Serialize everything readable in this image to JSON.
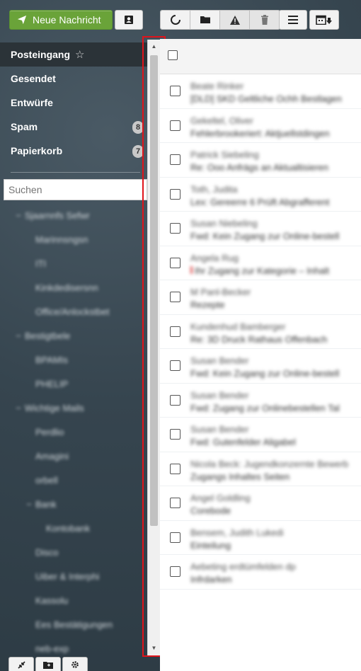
{
  "toolbar": {
    "compose_label": "Neue Nachricht"
  },
  "sidebar": {
    "folders": [
      {
        "label": "Posteingang",
        "badge": ""
      },
      {
        "label": "Gesendet",
        "badge": ""
      },
      {
        "label": "Entwürfe",
        "badge": ""
      },
      {
        "label": "Spam",
        "badge": "8"
      },
      {
        "label": "Papierkorb",
        "badge": "7"
      }
    ],
    "search_placeholder": "Suchen",
    "tree": [
      {
        "label": "Sjaarnnfs Sefwr",
        "depth": 0,
        "toggle": "−"
      },
      {
        "label": "Marinnsngsn",
        "depth": 1,
        "toggle": ""
      },
      {
        "label": "ITI",
        "depth": 1,
        "toggle": ""
      },
      {
        "label": "Kinkdedisersnn",
        "depth": 1,
        "toggle": ""
      },
      {
        "label": "Office/Anlockstbet",
        "depth": 1,
        "toggle": ""
      },
      {
        "label": "Bestigtbele",
        "depth": 0,
        "toggle": "−"
      },
      {
        "label": "BPAMIs",
        "depth": 1,
        "toggle": ""
      },
      {
        "label": "PHELIP",
        "depth": 1,
        "toggle": ""
      },
      {
        "label": "Wichtige Mails",
        "depth": 0,
        "toggle": "−"
      },
      {
        "label": "Perdlio",
        "depth": 1,
        "toggle": ""
      },
      {
        "label": "Amagini",
        "depth": 1,
        "toggle": ""
      },
      {
        "label": "orbell",
        "depth": 1,
        "toggle": ""
      },
      {
        "label": "Bank",
        "depth": 1,
        "toggle": "−"
      },
      {
        "label": "Kontobank",
        "depth": 2,
        "toggle": ""
      },
      {
        "label": "Disco",
        "depth": 1,
        "toggle": ""
      },
      {
        "label": "Uiber & Interphi",
        "depth": 1,
        "toggle": ""
      },
      {
        "label": "Kassolu",
        "depth": 1,
        "toggle": ""
      },
      {
        "label": "Ees Bestätigungen",
        "depth": 1,
        "toggle": ""
      },
      {
        "label": "neb-exp",
        "depth": 1,
        "toggle": ""
      }
    ]
  },
  "mails": [
    {
      "from": "Beate Rinker",
      "subject": "[DLD] SKD Geltliche Ochh Bestlagen",
      "flag": false
    },
    {
      "from": "Gekeltel, Oliver",
      "subject": "Fehlerbrookeriert: Aktjuellstdingen",
      "flag": false
    },
    {
      "from": "Patrick Siebeling",
      "subject": "Re: Ooo Anfrägs an Aktualtisieren",
      "flag": false
    },
    {
      "from": "Toth, Judita",
      "subject": "Lex: Gereerre 6 Prüft Abgrafferent",
      "flag": false
    },
    {
      "from": "Susan Niebeling",
      "subject": "Fwd: Kein Zugang zur Online-bestell",
      "flag": false
    },
    {
      "from": "Angela Rug",
      "subject": "Ihr Zugang zur Kategorie – Inhalt",
      "flag": true
    },
    {
      "from": "M Panl-Becker",
      "subject": "Rezepte",
      "flag": false
    },
    {
      "from": "Kundenhud Bamberger",
      "subject": "Re: 3D Druck Rathaus Offenbach",
      "flag": false
    },
    {
      "from": "Susan Bender",
      "subject": "Fwd: Kein Zugang zur Online-bestell",
      "flag": false
    },
    {
      "from": "Susan Bender",
      "subject": "Fwd: Zugang zur Onlinebestellen Tal",
      "flag": false
    },
    {
      "from": "Susan Bender",
      "subject": "Fwd: Gutenfelder Aligabel",
      "flag": false
    },
    {
      "from": "Nicola Beck: Jugendkonzernte Bewerb",
      "subject": "Zugangs Inhaltes Seiten",
      "flag": false
    },
    {
      "from": "Angel Goldling",
      "subject": "Corebode",
      "flag": false
    },
    {
      "from": "Bensem, Judith Lukedi",
      "subject": "Einteilung",
      "flag": false
    },
    {
      "from": "Aebeting erdtümfelden dp",
      "subject": "Infrdarken",
      "flag": false
    }
  ],
  "colors": {
    "compose_bg": "#6aa339",
    "sidebar_bg": "#36454f",
    "highlight_border": "#e0141b"
  }
}
